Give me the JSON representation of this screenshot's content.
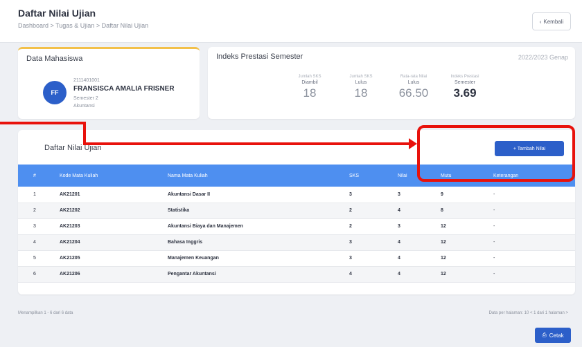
{
  "header": {
    "title": "Daftar Nilai Ujian",
    "subtitle": "Dashboard > Tugas & Ujian > Daftar Nilai Ujian",
    "back_label": "Kembali"
  },
  "mahasiswa": {
    "card_title": "Data Mahasiswa",
    "avatar_initials": "FF",
    "nim": "2111401001",
    "nama": "FRANSISCA AMALIA FRISNER",
    "semester": "Semester 2",
    "prodi": "Akuntansi"
  },
  "ips": {
    "card_title": "Indeks Prestasi Semester",
    "periode": "2022/2023 Genap",
    "stats": [
      {
        "l1": "Jumlah SKS",
        "l2": "Diambil",
        "value": "18"
      },
      {
        "l1": "Jumlah SKS",
        "l2": "Lulus",
        "value": "18"
      },
      {
        "l1": "Rata-rata Nilai",
        "l2": "Lulus",
        "value": "66.50"
      },
      {
        "l1": "Indeks Prestasi",
        "l2": "Semester",
        "value": "3.69"
      }
    ]
  },
  "table": {
    "title": "Daftar Nilai Ujian",
    "add_button": "+ Tambah Nilai",
    "headers": [
      "#",
      "Kode Mata Kuliah",
      "Nama Mata Kuliah",
      "SKS",
      "Nilai",
      "Mutu",
      "Keterangan"
    ],
    "rows": [
      [
        "1",
        "AK21201",
        "Akuntansi Dasar II",
        "3",
        "3",
        "9",
        "-"
      ],
      [
        "2",
        "AK21202",
        "Statistika",
        "2",
        "4",
        "8",
        "-"
      ],
      [
        "3",
        "AK21203",
        "Akuntansi Biaya dan Manajemen",
        "2",
        "3",
        "12",
        "-"
      ],
      [
        "4",
        "AK21204",
        "Bahasa Inggris",
        "3",
        "4",
        "12",
        "-"
      ],
      [
        "5",
        "AK21205",
        "Manajemen Keuangan",
        "3",
        "4",
        "12",
        "-"
      ],
      [
        "6",
        "AK21206",
        "Pengantar Akuntansi",
        "4",
        "4",
        "12",
        "-"
      ]
    ]
  },
  "footer": {
    "left": "Menampilkan 1 - 6 dari 6 data",
    "right": "Data per halaman: 10  < 1 dari 1 halaman >",
    "print_label": "Cetak"
  }
}
